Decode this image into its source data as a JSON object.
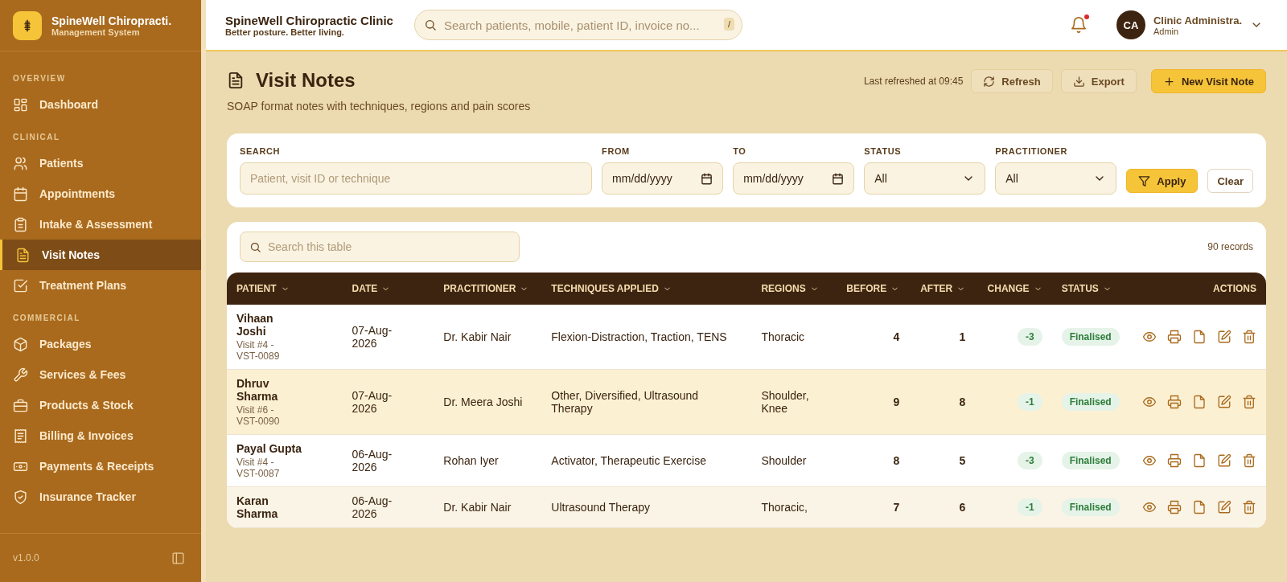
{
  "sidebar": {
    "brand_title": "SpineWell Chiropracti.",
    "brand_subtitle": "Management System",
    "sections": [
      {
        "heading": "OVERVIEW",
        "items": [
          {
            "label": "Dashboard",
            "kind": "dashboard",
            "selected": false
          }
        ]
      },
      {
        "heading": "CLINICAL",
        "items": [
          {
            "label": "Patients",
            "kind": "patients",
            "selected": false
          },
          {
            "label": "Appointments",
            "kind": "appointments",
            "selected": false
          },
          {
            "label": "Intake & Assessment",
            "kind": "intake",
            "selected": false
          },
          {
            "label": "Visit Notes",
            "kind": "notes",
            "selected": true
          },
          {
            "label": "Treatment Plans",
            "kind": "plans",
            "selected": false
          }
        ]
      },
      {
        "heading": "COMMERCIAL",
        "items": [
          {
            "label": "Packages",
            "kind": "packages",
            "selected": false
          },
          {
            "label": "Services & Fees",
            "kind": "services",
            "selected": false
          },
          {
            "label": "Products & Stock",
            "kind": "products",
            "selected": false
          },
          {
            "label": "Billing & Invoices",
            "kind": "billing",
            "selected": false
          },
          {
            "label": "Payments & Receipts",
            "kind": "payments",
            "selected": false
          },
          {
            "label": "Insurance Tracker",
            "kind": "insurance",
            "selected": false
          }
        ]
      }
    ],
    "version": "v1.0.0"
  },
  "topbar": {
    "title": "SpineWell Chiropractic Clinic",
    "tagline": "Better posture. Better living.",
    "search": {
      "placeholder": "Search patients, mobile, patient ID, invoice no...",
      "shortcut": "/"
    },
    "notifications_unread": true,
    "user": {
      "initials": "CA",
      "name": "Clinic Administra.",
      "role": "Admin"
    }
  },
  "page": {
    "title": "Visit Notes",
    "subtitle": "SOAP format notes with techniques, regions and pain scores",
    "last_refreshed": "Last refreshed at 09:45",
    "buttons": [
      {
        "label": "Refresh",
        "kind": "refresh"
      },
      {
        "label": "Export",
        "kind": "export"
      },
      {
        "label": "New Visit Note",
        "kind": "primary"
      }
    ]
  },
  "filters": {
    "fields": [
      {
        "label": "SEARCH",
        "kind": "text",
        "placeholder": "Patient, visit ID or technique"
      },
      {
        "label": "FROM",
        "kind": "date",
        "value": "mm/dd/yyyy"
      },
      {
        "label": "TO",
        "kind": "date",
        "value": "mm/dd/yyyy"
      },
      {
        "label": "STATUS",
        "kind": "select",
        "value": "All"
      },
      {
        "label": "PRACTITIONER",
        "kind": "select",
        "value": "All"
      }
    ],
    "apply": "Apply",
    "clear": "Clear"
  },
  "table": {
    "search_placeholder": "Search this table",
    "record_count": "90 records",
    "columns": [
      {
        "label": "PATIENT",
        "sortable": true
      },
      {
        "label": "DATE",
        "sortable": true
      },
      {
        "label": "PRACTITIONER",
        "sortable": true
      },
      {
        "label": "TECHNIQUES APPLIED",
        "sortable": true
      },
      {
        "label": "REGIONS",
        "sortable": true
      },
      {
        "label": "BEFORE",
        "sortable": true
      },
      {
        "label": "AFTER",
        "sortable": true
      },
      {
        "label": "CHANGE",
        "sortable": true
      },
      {
        "label": "STATUS",
        "sortable": true
      },
      {
        "label": "ACTIONS",
        "sortable": false
      }
    ],
    "rows": [
      {
        "patient": "Vihaan Joshi",
        "visit": "Visit #4 - VST-0089",
        "date": "07-Aug-2026",
        "practitioner": "Dr. Kabir Nair",
        "techniques": "Flexion-Distraction, Traction, TENS",
        "regions": "Thoracic",
        "before": "4",
        "after": "1",
        "change": "-3",
        "status": "Finalised",
        "selected": false
      },
      {
        "patient": "Dhruv Sharma",
        "visit": "Visit #6 - VST-0090",
        "date": "07-Aug-2026",
        "practitioner": "Dr. Meera Joshi",
        "techniques": "Other, Diversified, Ultrasound Therapy",
        "regions": "Shoulder, Knee",
        "before": "9",
        "after": "8",
        "change": "-1",
        "status": "Finalised",
        "selected": true
      },
      {
        "patient": "Payal Gupta",
        "visit": "Visit #4 - VST-0087",
        "date": "06-Aug-2026",
        "practitioner": "Rohan Iyer",
        "techniques": "Activator, Therapeutic Exercise",
        "regions": "Shoulder",
        "before": "8",
        "after": "5",
        "change": "-3",
        "status": "Finalised",
        "selected": false
      },
      {
        "patient": "Karan Sharma",
        "date": "06-Aug-2026",
        "practitioner": "Dr. Kabir Nair",
        "techniques": "Ultrasound Therapy",
        "regions": "Thoracic,",
        "before": "7",
        "after": "6",
        "change": "-1",
        "status": "Finalised",
        "selected": false
      }
    ]
  }
}
